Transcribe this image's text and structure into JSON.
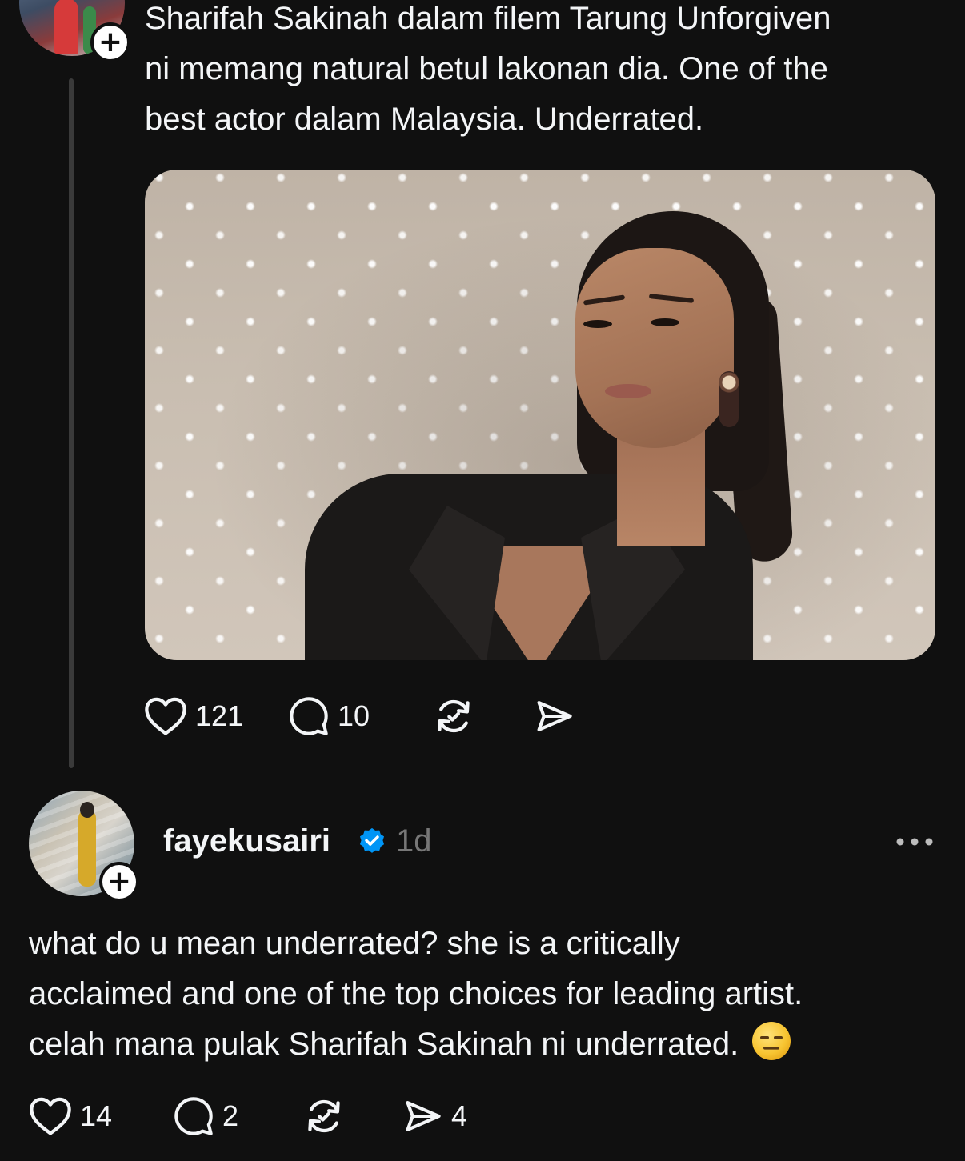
{
  "thread": {
    "parent_post": {
      "avatar": "profile-photo",
      "follow_badge": "+",
      "text_lines": [
        "Sharifah Sakinah dalam filem Tarung Unforgiven",
        "ni memang natural betul lakonan dia. One of the",
        "best actor dalam Malaysia. Underrated."
      ],
      "image": "portrait-photo",
      "actions": {
        "like_icon": "heart-icon",
        "likes": "121",
        "reply_icon": "comment-icon",
        "replies": "10",
        "repost_icon": "repost-icon",
        "share_icon": "send-icon"
      }
    },
    "reply_post": {
      "avatar": "profile-photo",
      "follow_badge": "+",
      "username": "fayekusairi",
      "verified_icon": "verified-badge-icon",
      "timestamp": "1d",
      "more_icon": "more-options-icon",
      "text_lines": [
        "what do u mean underrated? she is a critically",
        "acclaimed and one of the top choices for leading artist.",
        "celah mana pulak Sharifah Sakinah ni underrated."
      ],
      "emoji": "expressionless-face-emoji",
      "actions": {
        "like_icon": "heart-icon",
        "likes": "14",
        "reply_icon": "comment-icon",
        "replies": "2",
        "repost_icon": "repost-icon",
        "share_icon": "send-icon",
        "shares": "4"
      }
    }
  },
  "colors": {
    "background": "#101010",
    "text_primary": "#f3f5f7",
    "text_secondary": "#777777",
    "thread_line": "#3a3a3a",
    "verified_blue": "#0095f6"
  }
}
